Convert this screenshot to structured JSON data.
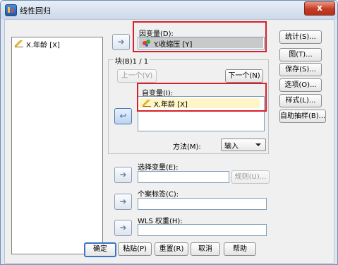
{
  "window": {
    "title": "线性回归",
    "close_label": "x"
  },
  "source_list": {
    "items": [
      {
        "label": "X.年龄 [X]",
        "icon": "ruler-icon"
      }
    ]
  },
  "dependent": {
    "label": "因变量(D):",
    "value": "Y.收缩压 [Y]",
    "icon": "nominal-icon"
  },
  "block": {
    "title": "块(B)1 / 1",
    "previous_label": "上一个(V)",
    "next_label": "下一个(N)"
  },
  "independent": {
    "label": "自变量(I):",
    "items": [
      {
        "label": "X.年龄 [X]",
        "icon": "ruler-icon"
      }
    ]
  },
  "method": {
    "label": "方法(M):",
    "value": "输入"
  },
  "selection": {
    "label": "选择变量(E):",
    "value": "",
    "rule_label": "规则(U)..."
  },
  "case_labels": {
    "label": "个案标签(C):",
    "value": ""
  },
  "wls": {
    "label": "WLS 权重(H):",
    "value": ""
  },
  "side_buttons": [
    "统计(S)...",
    "图(T)...",
    "保存(S)...",
    "选项(O)...",
    "样式(L)...",
    "自助抽样(B)..."
  ],
  "bottom_buttons": {
    "ok": "确定",
    "paste": "粘贴(P)",
    "reset": "重置(R)",
    "cancel": "取消",
    "help": "帮助"
  },
  "colors": {
    "highlight_border": "#d8202a",
    "title_bar": "#dfe6ef",
    "selected_item_bg": "#fff6c8"
  }
}
